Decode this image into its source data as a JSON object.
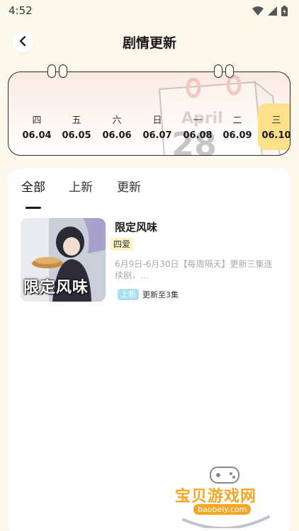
{
  "status_bar": {
    "time": "4:52"
  },
  "header": {
    "title": "剧情更新"
  },
  "calendar": {
    "deco_month": "April",
    "deco_day": "28",
    "days": [
      {
        "weekday": "四",
        "date": "06.04"
      },
      {
        "weekday": "五",
        "date": "06.05"
      },
      {
        "weekday": "六",
        "date": "06.06"
      },
      {
        "weekday": "日",
        "date": "06.07"
      },
      {
        "weekday": "一",
        "date": "06.08"
      },
      {
        "weekday": "二",
        "date": "06.09"
      },
      {
        "weekday": "三",
        "date": "06.10",
        "selected": true
      }
    ]
  },
  "tabs": [
    {
      "label": "全部",
      "selected": true
    },
    {
      "label": "上新"
    },
    {
      "label": "更新"
    }
  ],
  "dramas": [
    {
      "title": "限定风味",
      "cover_text": "限定风味",
      "tag": "四爱",
      "description": "6月9日-6月30日【每周隔天】更新三集连续剧，…",
      "badge": "上新",
      "update_status": "更新至3集"
    }
  ],
  "watermark": {
    "text": "宝贝游戏网",
    "url": "baobeiy.com"
  },
  "colors": {
    "background": "#fdf8ec",
    "selected_day": "#ffe08a",
    "tag_bg": "#fff3c4",
    "badge_bg": "#a9dff0",
    "watermark": "#f5a623"
  }
}
